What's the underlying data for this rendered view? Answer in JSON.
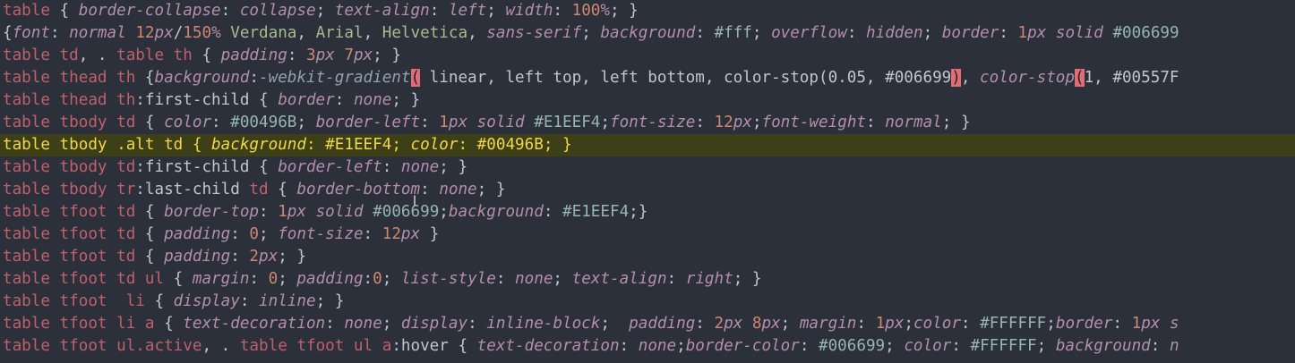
{
  "editor": {
    "highlighted_line_index": 6,
    "cursor_glyph": "I",
    "colors": {
      "background": "#2b303b",
      "selector": "#bf616a",
      "property": "#b48ead",
      "number": "#d08770",
      "color_value": "#96b5b4",
      "font_name": "#a3be8c",
      "invalid_mark": "#e06c75",
      "highlight_bg": "#3d3f16",
      "highlight_text": "#f2d64a"
    },
    "lines": [
      [
        [
          "sel",
          "table"
        ],
        [
          "txt",
          " { "
        ],
        [
          "prop",
          "border-collapse"
        ],
        [
          "txt",
          ": "
        ],
        [
          "prop",
          "collapse"
        ],
        [
          "txt",
          "; "
        ],
        [
          "prop",
          "text-align"
        ],
        [
          "txt",
          ": "
        ],
        [
          "prop",
          "left"
        ],
        [
          "txt",
          "; "
        ],
        [
          "prop",
          "width"
        ],
        [
          "txt",
          ": "
        ],
        [
          "num",
          "100"
        ],
        [
          "prop",
          "%"
        ],
        [
          "txt",
          "; }"
        ]
      ],
      [
        [
          "txt",
          "{"
        ],
        [
          "prop",
          "font"
        ],
        [
          "txt",
          ": "
        ],
        [
          "prop",
          "normal"
        ],
        [
          "txt",
          " "
        ],
        [
          "num",
          "12"
        ],
        [
          "prop",
          "px"
        ],
        [
          "txt",
          "/"
        ],
        [
          "num",
          "150"
        ],
        [
          "prop",
          "%"
        ],
        [
          "txt",
          " "
        ],
        [
          "str",
          "Verdana"
        ],
        [
          "txt",
          ", "
        ],
        [
          "str",
          "Arial"
        ],
        [
          "txt",
          ", "
        ],
        [
          "str",
          "Helvetica"
        ],
        [
          "txt",
          ", "
        ],
        [
          "prop",
          "sans-serif"
        ],
        [
          "txt",
          "; "
        ],
        [
          "prop",
          "background"
        ],
        [
          "txt",
          ": "
        ],
        [
          "col",
          "#fff"
        ],
        [
          "txt",
          "; "
        ],
        [
          "prop",
          "overflow"
        ],
        [
          "txt",
          ": "
        ],
        [
          "prop",
          "hidden"
        ],
        [
          "txt",
          "; "
        ],
        [
          "prop",
          "border"
        ],
        [
          "txt",
          ": "
        ],
        [
          "num",
          "1"
        ],
        [
          "prop",
          "px"
        ],
        [
          "txt",
          " "
        ],
        [
          "prop",
          "solid"
        ],
        [
          "txt",
          " "
        ],
        [
          "col",
          "#006699"
        ]
      ],
      [
        [
          "sel",
          "table td"
        ],
        [
          "txt",
          ", . "
        ],
        [
          "sel",
          "table th"
        ],
        [
          "txt",
          " { "
        ],
        [
          "prop",
          "padding"
        ],
        [
          "txt",
          ": "
        ],
        [
          "num",
          "3"
        ],
        [
          "prop",
          "px"
        ],
        [
          "txt",
          " "
        ],
        [
          "num",
          "7"
        ],
        [
          "prop",
          "px"
        ],
        [
          "txt",
          "; }"
        ]
      ],
      [
        [
          "sel",
          "table thead th"
        ],
        [
          "txt",
          " {"
        ],
        [
          "prop",
          "background"
        ],
        [
          "txt",
          ":"
        ],
        [
          "fn",
          "-webkit-gradient"
        ],
        [
          "bad",
          "("
        ],
        [
          "txt",
          " linear, left top, left bottom, color-stop(0.05, #006699"
        ],
        [
          "bad",
          ")"
        ],
        [
          "txt",
          ", "
        ],
        [
          "fnr",
          "color-stop"
        ],
        [
          "bad",
          "("
        ],
        [
          "txt",
          "1, #00557F"
        ]
      ],
      [
        [
          "sel",
          "table thead th"
        ],
        [
          "txt",
          ":first-child { "
        ],
        [
          "prop",
          "border"
        ],
        [
          "txt",
          ": "
        ],
        [
          "prop",
          "none"
        ],
        [
          "txt",
          "; }"
        ]
      ],
      [
        [
          "sel",
          "table tbody td"
        ],
        [
          "txt",
          " { "
        ],
        [
          "prop",
          "color"
        ],
        [
          "txt",
          ": "
        ],
        [
          "col",
          "#00496B"
        ],
        [
          "txt",
          "; "
        ],
        [
          "prop",
          "border-left"
        ],
        [
          "txt",
          ": "
        ],
        [
          "num",
          "1"
        ],
        [
          "prop",
          "px"
        ],
        [
          "txt",
          " "
        ],
        [
          "prop",
          "solid"
        ],
        [
          "txt",
          " "
        ],
        [
          "col",
          "#E1EEF4"
        ],
        [
          "txt",
          ";"
        ],
        [
          "prop",
          "font-size"
        ],
        [
          "txt",
          ": "
        ],
        [
          "num",
          "12"
        ],
        [
          "prop",
          "px"
        ],
        [
          "txt",
          ";"
        ],
        [
          "prop",
          "font-weight"
        ],
        [
          "txt",
          ": "
        ],
        [
          "prop",
          "normal"
        ],
        [
          "txt",
          "; }"
        ]
      ],
      [
        [
          "sel",
          "table tbody .alt td"
        ],
        [
          "txt",
          " { "
        ],
        [
          "prop",
          "background"
        ],
        [
          "txt",
          ": "
        ],
        [
          "col",
          "#E1EEF4"
        ],
        [
          "txt",
          "; "
        ],
        [
          "prop",
          "color"
        ],
        [
          "txt",
          ": "
        ],
        [
          "col",
          "#00496B"
        ],
        [
          "txt",
          "; }"
        ]
      ],
      [
        [
          "sel",
          "table tbody td"
        ],
        [
          "txt",
          ":first-child { "
        ],
        [
          "prop",
          "border-left"
        ],
        [
          "txt",
          ": "
        ],
        [
          "prop",
          "none"
        ],
        [
          "txt",
          "; }"
        ]
      ],
      [
        [
          "sel",
          "table tbody tr"
        ],
        [
          "txt",
          ":last-child "
        ],
        [
          "sel",
          "td"
        ],
        [
          "txt",
          " { "
        ],
        [
          "prop",
          "border-bottom"
        ],
        [
          "txt",
          ": "
        ],
        [
          "prop",
          "none"
        ],
        [
          "txt",
          "; }"
        ]
      ],
      [
        [
          "sel",
          "table tfoot td"
        ],
        [
          "txt",
          " { "
        ],
        [
          "prop",
          "border-top"
        ],
        [
          "txt",
          ": "
        ],
        [
          "num",
          "1"
        ],
        [
          "prop",
          "px"
        ],
        [
          "txt",
          " "
        ],
        [
          "prop",
          "solid"
        ],
        [
          "txt",
          " "
        ],
        [
          "col",
          "#006699"
        ],
        [
          "txt",
          ";"
        ],
        [
          "prop",
          "background"
        ],
        [
          "txt",
          ": "
        ],
        [
          "col",
          "#E1EEF4"
        ],
        [
          "txt",
          ";}"
        ]
      ],
      [
        [
          "sel",
          "table tfoot td"
        ],
        [
          "txt",
          " { "
        ],
        [
          "prop",
          "padding"
        ],
        [
          "txt",
          ": "
        ],
        [
          "num",
          "0"
        ],
        [
          "txt",
          "; "
        ],
        [
          "prop",
          "font-size"
        ],
        [
          "txt",
          ": "
        ],
        [
          "num",
          "12"
        ],
        [
          "prop",
          "px"
        ],
        [
          "txt",
          " }"
        ]
      ],
      [
        [
          "sel",
          "table tfoot td"
        ],
        [
          "txt",
          " { "
        ],
        [
          "prop",
          "padding"
        ],
        [
          "txt",
          ": "
        ],
        [
          "num",
          "2"
        ],
        [
          "prop",
          "px"
        ],
        [
          "txt",
          "; }"
        ]
      ],
      [
        [
          "sel",
          "table tfoot td ul"
        ],
        [
          "txt",
          " { "
        ],
        [
          "prop",
          "margin"
        ],
        [
          "txt",
          ": "
        ],
        [
          "num",
          "0"
        ],
        [
          "txt",
          "; "
        ],
        [
          "prop",
          "padding"
        ],
        [
          "txt",
          ":"
        ],
        [
          "num",
          "0"
        ],
        [
          "txt",
          "; "
        ],
        [
          "prop",
          "list-style"
        ],
        [
          "txt",
          ": "
        ],
        [
          "prop",
          "none"
        ],
        [
          "txt",
          "; "
        ],
        [
          "prop",
          "text-align"
        ],
        [
          "txt",
          ": "
        ],
        [
          "prop",
          "right"
        ],
        [
          "txt",
          "; }"
        ]
      ],
      [
        [
          "sel",
          "table tfoot  li"
        ],
        [
          "txt",
          " { "
        ],
        [
          "prop",
          "display"
        ],
        [
          "txt",
          ": "
        ],
        [
          "prop",
          "inline"
        ],
        [
          "txt",
          "; }"
        ]
      ],
      [
        [
          "sel",
          "table tfoot li a"
        ],
        [
          "txt",
          " { "
        ],
        [
          "prop",
          "text-decoration"
        ],
        [
          "txt",
          ": "
        ],
        [
          "prop",
          "none"
        ],
        [
          "txt",
          "; "
        ],
        [
          "prop",
          "display"
        ],
        [
          "txt",
          ": "
        ],
        [
          "prop",
          "inline-block"
        ],
        [
          "txt",
          ";  "
        ],
        [
          "prop",
          "padding"
        ],
        [
          "txt",
          ": "
        ],
        [
          "num",
          "2"
        ],
        [
          "prop",
          "px"
        ],
        [
          "txt",
          " "
        ],
        [
          "num",
          "8"
        ],
        [
          "prop",
          "px"
        ],
        [
          "txt",
          "; "
        ],
        [
          "prop",
          "margin"
        ],
        [
          "txt",
          ": "
        ],
        [
          "num",
          "1"
        ],
        [
          "prop",
          "px"
        ],
        [
          "txt",
          ";"
        ],
        [
          "prop",
          "color"
        ],
        [
          "txt",
          ": "
        ],
        [
          "col",
          "#FFFFFF"
        ],
        [
          "txt",
          ";"
        ],
        [
          "prop",
          "border"
        ],
        [
          "txt",
          ": "
        ],
        [
          "num",
          "1"
        ],
        [
          "prop",
          "px"
        ],
        [
          "txt",
          " "
        ],
        [
          "prop",
          "s"
        ]
      ],
      [
        [
          "sel",
          "table tfoot ul.active"
        ],
        [
          "txt",
          ", . "
        ],
        [
          "sel",
          "table tfoot ul a"
        ],
        [
          "txt",
          ":hover { "
        ],
        [
          "prop",
          "text-decoration"
        ],
        [
          "txt",
          ": "
        ],
        [
          "prop",
          "none"
        ],
        [
          "txt",
          ";"
        ],
        [
          "prop",
          "border-color"
        ],
        [
          "txt",
          ": "
        ],
        [
          "col",
          "#006699"
        ],
        [
          "txt",
          "; "
        ],
        [
          "prop",
          "color"
        ],
        [
          "txt",
          ": "
        ],
        [
          "col",
          "#FFFFFF"
        ],
        [
          "txt",
          "; "
        ],
        [
          "prop",
          "background"
        ],
        [
          "txt",
          ": "
        ],
        [
          "prop",
          "n"
        ]
      ]
    ]
  }
}
